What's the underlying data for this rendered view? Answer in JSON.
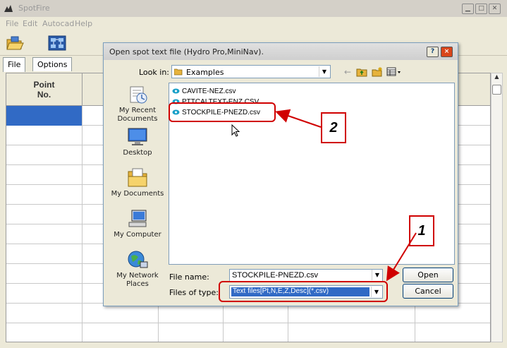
{
  "app": {
    "title": "SpotFire",
    "menu": [
      "File",
      "Edit",
      "Autocad",
      "Help"
    ],
    "window_controls": {
      "minimize": "minimize-icon",
      "maximize": "maximize-icon",
      "close": "close-icon"
    }
  },
  "tabs": [
    {
      "label": "File",
      "active": true
    },
    {
      "label": "Options",
      "active": false
    }
  ],
  "grid": {
    "columns": [
      {
        "label": "Point\nNo."
      },
      {
        "label": ""
      },
      {
        "label": ""
      },
      {
        "label": ""
      },
      {
        "label": ""
      },
      {
        "label": ""
      },
      {
        "label": ""
      }
    ]
  },
  "dialog": {
    "title": "Open spot text file (Hydro Pro,MiniNav).",
    "help_label": "?",
    "close_label": "×",
    "look_in_label": "Look in:",
    "look_in_value": "Examples",
    "places": [
      {
        "label": "My Recent Documents",
        "icon": "recent-documents-icon"
      },
      {
        "label": "Desktop",
        "icon": "desktop-icon"
      },
      {
        "label": "My Documents",
        "icon": "my-documents-icon"
      },
      {
        "label": "My Computer",
        "icon": "my-computer-icon"
      },
      {
        "label": "My Network Places",
        "icon": "network-places-icon"
      }
    ],
    "files": [
      {
        "name": "CAVITE-NEZ.csv"
      },
      {
        "name": "PTTCALTEXT-ENZ.CSV"
      },
      {
        "name": "STOCKPILE-PNEZD.csv"
      }
    ],
    "file_name_label": "File name:",
    "file_name_value": "STOCKPILE-PNEZD.csv",
    "files_of_type_label": "Files of type:",
    "files_of_type_value": "Text files[Pt,N,E,Z,Desc](*.csv)",
    "open_label": "Open",
    "cancel_label": "Cancel"
  },
  "annotations": [
    {
      "number": "1",
      "target": "files-of-type"
    },
    {
      "number": "2",
      "target": "stockpile-file"
    }
  ],
  "colors": {
    "selection": "#316ac5",
    "annotation_red": "#d00000",
    "dialog_bg": "#ece9d8"
  }
}
